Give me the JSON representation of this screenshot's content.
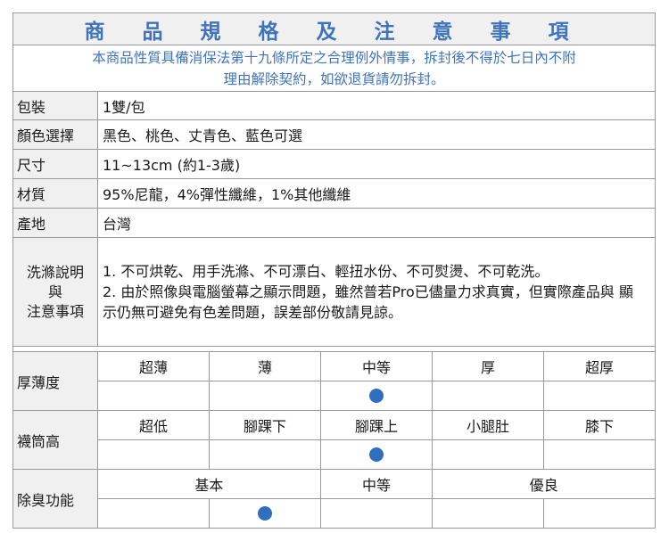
{
  "title": "商 品 規 格 及 注 意 事 項",
  "notice_line1": "本商品性質具備消保法第十九條所定之合理例外情事，拆封後不得於七日內不附",
  "notice_line2": "理由解除契約，如欲退貨請勿拆封。",
  "specs": [
    {
      "label": "包裝",
      "value": "1雙/包"
    },
    {
      "label": "顏色選擇",
      "value": "黑色、桃色、丈青色、藍色可選"
    },
    {
      "label": "尺寸",
      "value": "11~13cm (約1-3歲)"
    },
    {
      "label": "材質",
      "value": "95%尼龍，4%彈性纖維，1%其他纖維"
    },
    {
      "label": "產地",
      "value": "台灣"
    }
  ],
  "care": {
    "label_line1": "洗滌說明",
    "label_line2": "與",
    "label_line3": "注意事項",
    "item1": "1.  不可烘乾、用手洗滌、不可漂白、輕扭水份、不可熨燙、不可乾洗。",
    "item2": "2.  由於照像與電腦螢幕之顯示問題，雖然普若Pro已儘量力求真實，但實際產品與 顯示仍無可避免有色差問題，誤差部份敬請見諒。"
  },
  "ratings": {
    "thickness": {
      "label": "厚薄度",
      "options": [
        "超薄",
        "薄",
        "中等",
        "厚",
        "超厚"
      ],
      "selected": "中等"
    },
    "sock_height": {
      "label": "襪筒高",
      "options": [
        "超低",
        "腳踝下",
        "腳踝上",
        "小腿肚",
        "膝下"
      ],
      "selected": "腳踝上"
    },
    "deodorant": {
      "label": "除臭功能",
      "options": [
        "基本",
        "中等",
        "優良"
      ],
      "selected": "基本"
    }
  },
  "colors": {
    "accent": "#3f74ba",
    "dot": "#2f6fbd",
    "label_bg": "#f0f0f0",
    "border": "#9a9a9a"
  }
}
